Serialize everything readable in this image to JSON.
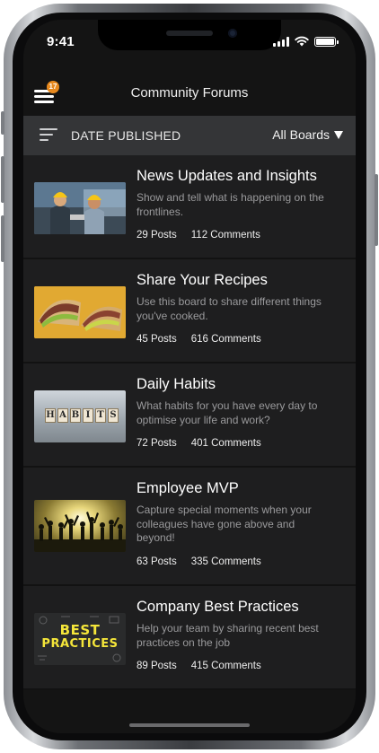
{
  "status_bar": {
    "time": "9:41"
  },
  "header": {
    "title": "Community Forums",
    "notification_count": "17"
  },
  "sort_bar": {
    "sort_label": "DATE PUBLISHED",
    "board_filter": "All Boards"
  },
  "boards": [
    {
      "title": "News Updates and Insights",
      "description": "Show and tell what is happening on the frontlines.",
      "posts": "29 Posts",
      "comments": "112 Comments",
      "image": "workers-in-hard-hats"
    },
    {
      "title": "Share Your Recipes",
      "description": "Use this board to share different things you've cooked.",
      "posts": "45 Posts",
      "comments": "616 Comments",
      "image": "sandwich"
    },
    {
      "title": "Daily Habits",
      "description": "What habits for you have every day to optimise your life and work?",
      "posts": "72 Posts",
      "comments": "401 Comments",
      "image": "habits-letter-blocks",
      "image_letters": [
        "H",
        "A",
        "B",
        "I",
        "T",
        "S"
      ]
    },
    {
      "title": "Employee MVP",
      "description": "Capture special moments when your colleagues have gone above and beyond!",
      "posts": "63 Posts",
      "comments": "335 Comments",
      "image": "celebrating-silhouettes"
    },
    {
      "title": "Company Best Practices",
      "description": "Help your team by sharing recent best practices on the job",
      "posts": "89 Posts",
      "comments": "415 Comments",
      "image": "best-practices-chalkboard",
      "image_text": [
        "BEST",
        "PRACTICES"
      ]
    }
  ],
  "colors": {
    "screen_bg": "#141414",
    "card_bg": "#1e1e1f",
    "sort_bar_bg": "#343537",
    "badge": "#e8891d",
    "muted_text": "#9a9a9c"
  }
}
